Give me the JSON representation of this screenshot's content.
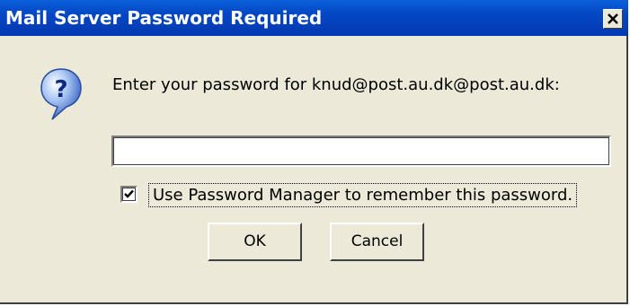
{
  "window": {
    "title": "Mail Server Password Required"
  },
  "icons": {
    "question": "question-icon",
    "close": "close-icon",
    "check": "checkmark-icon"
  },
  "prompt": {
    "text": "Enter your password for knud@post.au.dk@post.au.dk:"
  },
  "password_field": {
    "value": "",
    "placeholder": ""
  },
  "remember": {
    "checked": true,
    "label": "Use Password Manager to remember this password."
  },
  "buttons": {
    "ok_label": "OK",
    "cancel_label": "Cancel"
  },
  "colors": {
    "titlebar": "#0446c4",
    "dialog_bg": "#ece9d8",
    "title_text": "#ffffff"
  }
}
